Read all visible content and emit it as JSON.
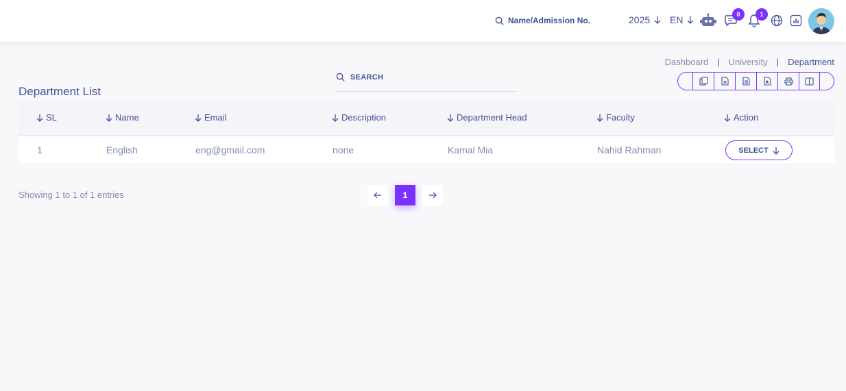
{
  "header": {
    "search_placeholder": "Name/Admission No.",
    "year": "2025",
    "language": "EN",
    "messages_count": "0",
    "notifications_count": "1"
  },
  "breadcrumb": [
    "Dashboard",
    "University",
    "Department"
  ],
  "page": {
    "title": "Department List",
    "search_label": "SEARCH"
  },
  "table": {
    "columns": [
      "SL",
      "Name",
      "Email",
      "Description",
      "Department Head",
      "Faculty",
      "Action"
    ],
    "rows": [
      {
        "sl": "1",
        "name": "English",
        "email": "eng@gmail.com",
        "description": "none",
        "head": "Kamal Mia",
        "faculty": "Nahid Rahman",
        "action": "SELECT"
      }
    ]
  },
  "footer": {
    "showing": "Showing 1 to 1 of 1 entries",
    "current_page": "1"
  },
  "colors": {
    "accent": "#7c32ff",
    "text": "#415094",
    "muted": "#828bb2"
  }
}
